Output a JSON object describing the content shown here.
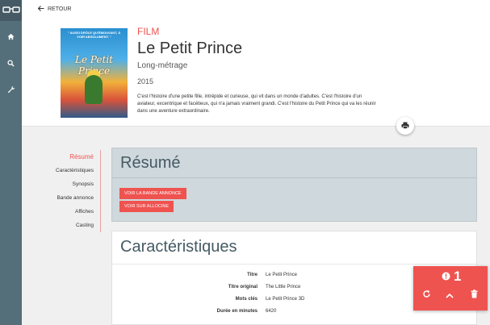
{
  "back": {
    "label": "RETOUR"
  },
  "film": {
    "kind": "FILM",
    "title": "Le Petit Prince",
    "subtitle": "Long-métrage",
    "year": "2015",
    "description": "C'est l'histoire d'une petite fille, intrépide et curieuse, qui vit dans un monde d'adultes. C'est l'histoire d'un aviateur, excentrique et facétieux, qui n'a jamais vraiment grandi. C'est l'histoire du Petit Prince qui va les réunir dans une aventure extraordinaire.",
    "poster": {
      "tagline": "\" AUSSI DRÔLE QU'ÉMOUVANT, À VOIR ABSOLUMENT. \"",
      "title": "Le Petit Prince"
    }
  },
  "menu": {
    "items": [
      {
        "label": "Résumé",
        "active": true
      },
      {
        "label": "Caractéristiques"
      },
      {
        "label": "Synopsis"
      },
      {
        "label": "Bande annonce"
      },
      {
        "label": "Affiches"
      },
      {
        "label": "Casting"
      }
    ]
  },
  "resume": {
    "heading": "Résumé",
    "buttons": [
      "VOIR LA BANDE ANNONCE",
      "VOIR SUR ALLOCINE"
    ]
  },
  "characteristics": {
    "heading": "Caractéristiques",
    "rows": [
      {
        "key": "Titre",
        "value": "Le Petit Prince"
      },
      {
        "key": "Titre original",
        "value": "The Little Prince"
      },
      {
        "key": "Mots clés",
        "value": "Le Petit Prince 3D"
      },
      {
        "key": "Durée en minutes",
        "value": "6420"
      }
    ]
  },
  "errors": {
    "count": "1"
  },
  "colors": {
    "accent": "#ef5350",
    "rail": "#546e7a",
    "heading": "#455a64"
  },
  "icons": [
    "glasses-icon",
    "home-icon",
    "search-icon",
    "wrench-icon",
    "arrow-left-icon",
    "print-icon",
    "alert-circle-icon",
    "refresh-icon",
    "chevron-up-icon",
    "trash-icon"
  ]
}
